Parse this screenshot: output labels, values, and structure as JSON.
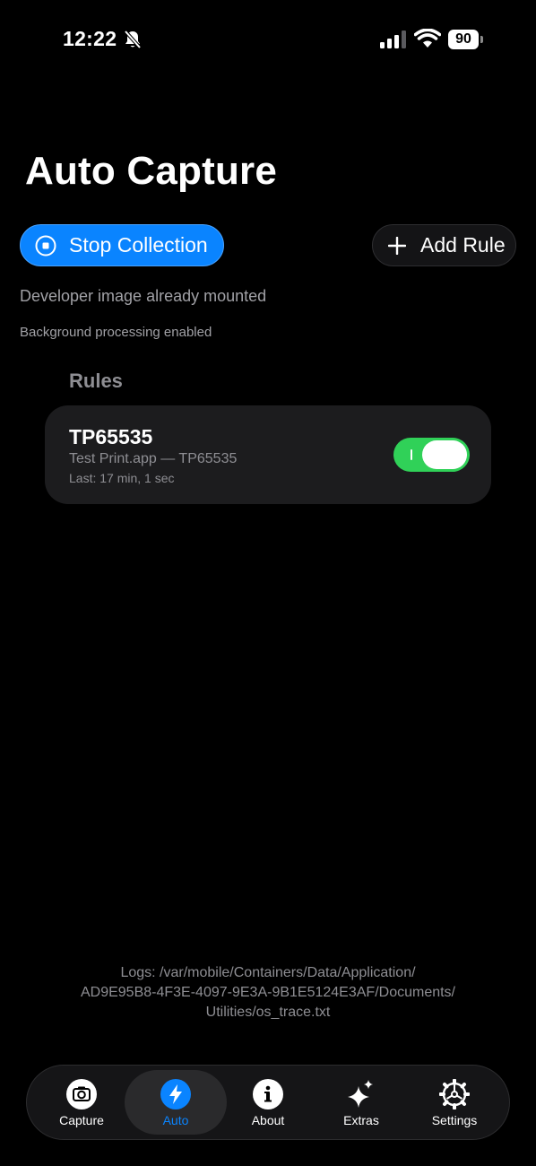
{
  "status_bar": {
    "time": "12:22",
    "battery": "90"
  },
  "page": {
    "title": "Auto Capture"
  },
  "actions": {
    "stop_label": "Stop Collection",
    "add_rule_label": "Add Rule"
  },
  "status": {
    "line1": "Developer image already mounted",
    "line2": "Background processing enabled"
  },
  "rules": {
    "header": "Rules",
    "items": [
      {
        "name": "TP65535",
        "subtitle": "Test Print.app — TP65535",
        "last": "Last: 17 min, 1 sec",
        "enabled": true
      }
    ]
  },
  "logs": {
    "line1": "Logs: /var/mobile/Containers/Data/Application/",
    "line2": "AD9E95B8-4F3E-4097-9E3A-9B1E5124E3AF/Documents/",
    "line3": "Utilities/os_trace.txt"
  },
  "tabs": [
    {
      "label": "Capture",
      "icon": "camera-icon"
    },
    {
      "label": "Auto",
      "icon": "bolt-icon",
      "active": true
    },
    {
      "label": "About",
      "icon": "info-icon"
    },
    {
      "label": "Extras",
      "icon": "sparkles-icon"
    },
    {
      "label": "Settings",
      "icon": "gear-icon"
    }
  ],
  "colors": {
    "accent": "#0a84ff",
    "toggle_on": "#30d158",
    "background": "#000000",
    "card": "#1c1c1e"
  }
}
